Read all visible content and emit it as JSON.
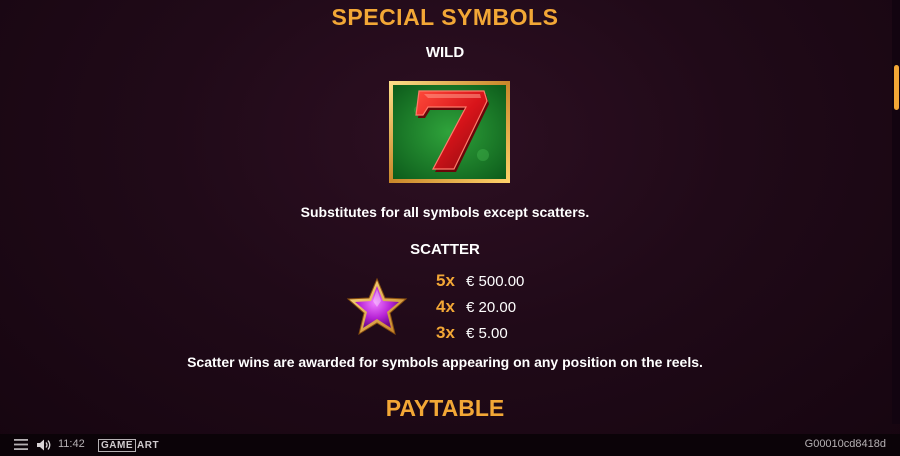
{
  "special_symbols_title": "SPECIAL SYMBOLS",
  "wild": {
    "title": "WILD",
    "symbol_icon": "red-seven-on-green",
    "description": "Substitutes for all symbols except scatters."
  },
  "scatter": {
    "title": "SCATTER",
    "symbol_icon": "purple-star",
    "payouts": [
      {
        "multiplier": "5x",
        "amount": "€ 500.00"
      },
      {
        "multiplier": "4x",
        "amount": "€ 20.00"
      },
      {
        "multiplier": "3x",
        "amount": "€ 5.00"
      }
    ],
    "description": "Scatter wins are awarded for symbols appearing on any position on the reels."
  },
  "paytable_title": "PAYTABLE",
  "bottom_bar": {
    "menu_icon": "hamburger-menu",
    "sound_icon": "speaker",
    "time": "11:42",
    "logo_part1": "GAME",
    "logo_part2": "ART",
    "game_id": "G00010cd8418d"
  },
  "colors": {
    "accent": "#f2a736",
    "background": "#200a18",
    "text": "#ffffff"
  }
}
